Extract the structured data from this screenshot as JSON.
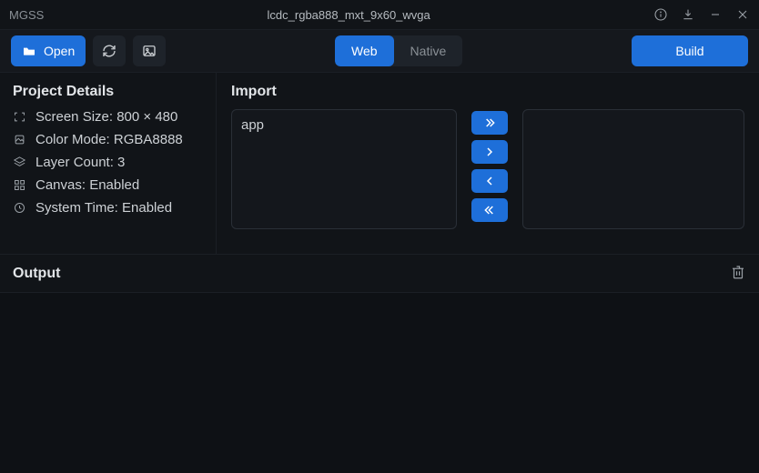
{
  "titlebar": {
    "app_name": "MGSS",
    "document_title": "lcdc_rgba888_mxt_9x60_wvga"
  },
  "toolbar": {
    "open_label": "Open",
    "segments": {
      "web": "Web",
      "native": "Native"
    },
    "build_label": "Build"
  },
  "project_details": {
    "title": "Project Details",
    "items": [
      {
        "label": "Screen Size: 800 × 480"
      },
      {
        "label": "Color Mode: RGBA8888"
      },
      {
        "label": "Layer Count: 3"
      },
      {
        "label": "Canvas: Enabled"
      },
      {
        "label": "System Time: Enabled"
      }
    ]
  },
  "import": {
    "title": "Import",
    "available_items": [
      "app"
    ]
  },
  "output": {
    "title": "Output"
  }
}
